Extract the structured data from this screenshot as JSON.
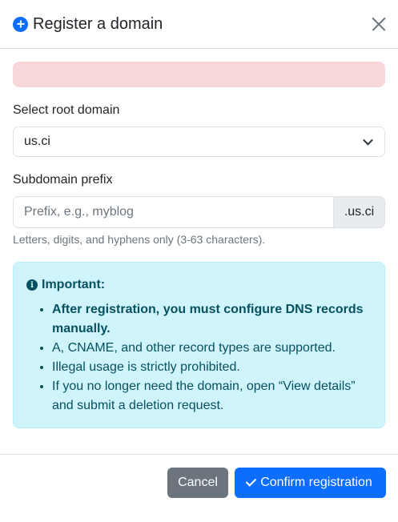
{
  "header": {
    "title": "Register a domain",
    "icon": "plus-circle-icon",
    "close_icon": "close-icon"
  },
  "alert": {
    "text": "",
    "color": "#f8d7da"
  },
  "root_domain": {
    "label": "Select root domain",
    "selected": "us.ci"
  },
  "subdomain": {
    "label": "Subdomain prefix",
    "placeholder": "Prefix, e.g., myblog",
    "value": "",
    "suffix": ".us.ci",
    "help": "Letters, digits, and hyphens only (3-63 characters)."
  },
  "info": {
    "icon": "info-circle-icon",
    "title": "Important:",
    "items": [
      "After registration, you must configure DNS records manually.",
      "A, CNAME, and other record types are supported.",
      "Illegal usage is strictly prohibited.",
      "If you no longer need the domain, open “View details” and submit a deletion request."
    ],
    "background": "#cff4fc",
    "text_color": "#055160"
  },
  "footer": {
    "cancel_label": "Cancel",
    "confirm_label": "Confirm registration",
    "confirm_icon": "check-icon",
    "primary_color": "#0d6efd",
    "secondary_color": "#6c757d"
  }
}
